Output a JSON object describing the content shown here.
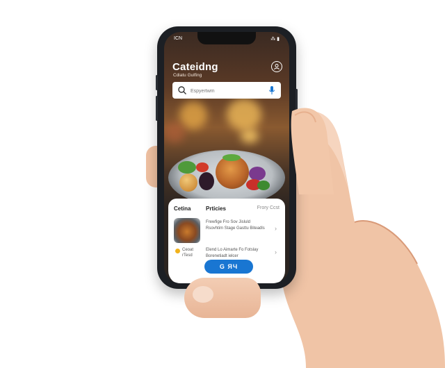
{
  "status_bar": {
    "time": "ICN",
    "system": "⁂ ▮"
  },
  "app": {
    "title": "Cateidng",
    "subtitle": "Cdiatu Gulfing",
    "profile_icon": "profile-icon"
  },
  "search": {
    "placeholder": "Espyertwm",
    "mic_icon": "mic-icon",
    "search_icon": "search-icon"
  },
  "panel": {
    "tabs": [
      "Cetina",
      "Prticies"
    ],
    "tab_right": "Frory Ccst",
    "items": [
      {
        "text": "Frewfige Fro Sov Jisluld Rsovhtim Stage Gasttu Biteadls"
      },
      {
        "label_line1": "Ceoat",
        "label_line2": "rTesd",
        "text": "Elend Lo Aimarte Fo Fotslay Borenetiadt ielcer"
      }
    ],
    "action_button": "G ЯЧ"
  },
  "colors": {
    "accent": "#1976d2",
    "background": "#ffffff",
    "phone": "#1c1f24"
  }
}
